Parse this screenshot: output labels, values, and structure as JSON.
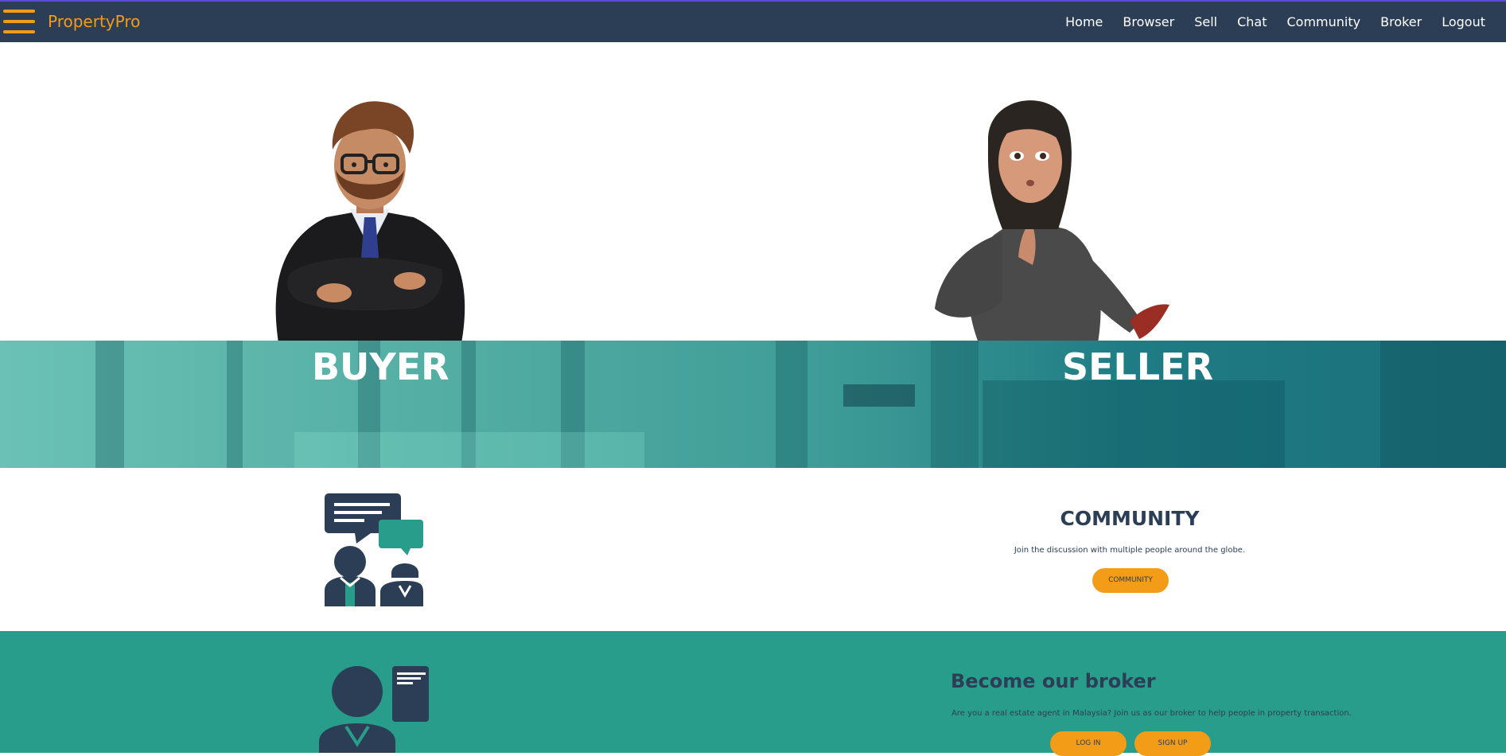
{
  "navbar": {
    "brand": "PropertyPro",
    "links": [
      "Home",
      "Browser",
      "Sell",
      "Chat",
      "Community",
      "Broker",
      "Logout"
    ]
  },
  "hero": {
    "buyer_label": "BUYER",
    "seller_label": "SELLER"
  },
  "community": {
    "title": "COMMUNITY",
    "description": "Join the discussion with multiple people around the globe.",
    "button_label": "COMMUNITY"
  },
  "broker": {
    "title": "Become our broker",
    "description": "Are you a real estate agent in Malaysia? Join us as our broker to help people in property transaction.",
    "login_label": "LOG IN",
    "signup_label": "SIGN UP"
  },
  "colors": {
    "navbar_bg": "#2c3e55",
    "accent": "#f39c18",
    "teal": "#289d8b",
    "hero_teal": "#3e9c97",
    "dark_text": "#2c3e55"
  },
  "icons": [
    "hamburger-menu-icon",
    "community-chat-icon",
    "broker-icon"
  ]
}
